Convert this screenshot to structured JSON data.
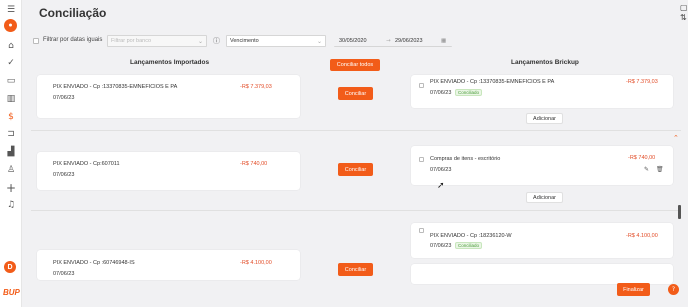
{
  "page": {
    "title": "Conciliação"
  },
  "sidebar": {
    "items": [
      {
        "icon": "menu-icon",
        "glyph": "☰"
      },
      {
        "icon": "orange-logo-icon",
        "glyph": "●"
      },
      {
        "icon": "bank-icon",
        "glyph": "⌂"
      },
      {
        "icon": "check-circle-icon",
        "glyph": "✓"
      },
      {
        "icon": "folder-icon",
        "glyph": "▭"
      },
      {
        "icon": "barcode-icon",
        "glyph": "▥"
      },
      {
        "icon": "dollar-icon",
        "glyph": "$"
      },
      {
        "icon": "cart-icon",
        "glyph": "⊐"
      },
      {
        "icon": "chart-icon",
        "glyph": "▟"
      },
      {
        "icon": "user-icon",
        "glyph": "♙"
      },
      {
        "icon": "plus-icon",
        "glyph": "+"
      },
      {
        "icon": "bell-icon",
        "glyph": "♫"
      }
    ],
    "avatar": "D",
    "logo": "BUP"
  },
  "filters": {
    "same_dates_label": "Filtrar por datas iguais",
    "bank_placeholder": "Filtrar por banco",
    "info_icon": "ⓘ",
    "date_type_value": "Vencimento",
    "date_from": "30/05/2020",
    "date_separator": "→",
    "date_to": "29/06/2023"
  },
  "columns": {
    "imported_header": "Lançamentos Importados",
    "brickup_header": "Lançamentos Brickup",
    "conciliate_all": "Conciliar todos"
  },
  "rows": [
    {
      "imported": {
        "desc": "PIX ENVIADO - Cp :13370835-EMNEFICIOS E PA",
        "date": "07/06/23",
        "value": "-R$ 7.379,03"
      },
      "action": "Conciliar",
      "brickup": {
        "desc": "PIX ENVIADO - Cp :13370835-EMNEFICIOS E PA",
        "date": "07/06/23",
        "badge": "Conciliado",
        "value": "-R$ 7.379,03"
      },
      "add_label": "Adicionar"
    },
    {
      "imported": {
        "desc": "PIX ENVIADO - Cp:607011",
        "date": "07/06/23",
        "value": "-R$ 740,00"
      },
      "action": "Conciliar",
      "brickup": {
        "desc": "Compras de itens - escritório",
        "date": "07/06/23",
        "value": "-R$ 740,00"
      },
      "add_label": "Adicionar"
    },
    {
      "imported": {
        "desc": "PIX ENVIADO - Cp :60746948-IS",
        "date": "07/06/23",
        "value": "-R$ 4.100,00"
      },
      "action": "Conciliar",
      "brickup": {
        "desc": "PIX ENVIADO - Cp :18236120-W",
        "date": "07/06/23",
        "badge": "Conciliado",
        "value": "-R$ 4.100,00"
      }
    }
  ],
  "footer": {
    "finalize": "Finalizar"
  },
  "colors": {
    "accent": "#f25c19",
    "negative": "#e24b26",
    "success": "#4a9b3a"
  }
}
